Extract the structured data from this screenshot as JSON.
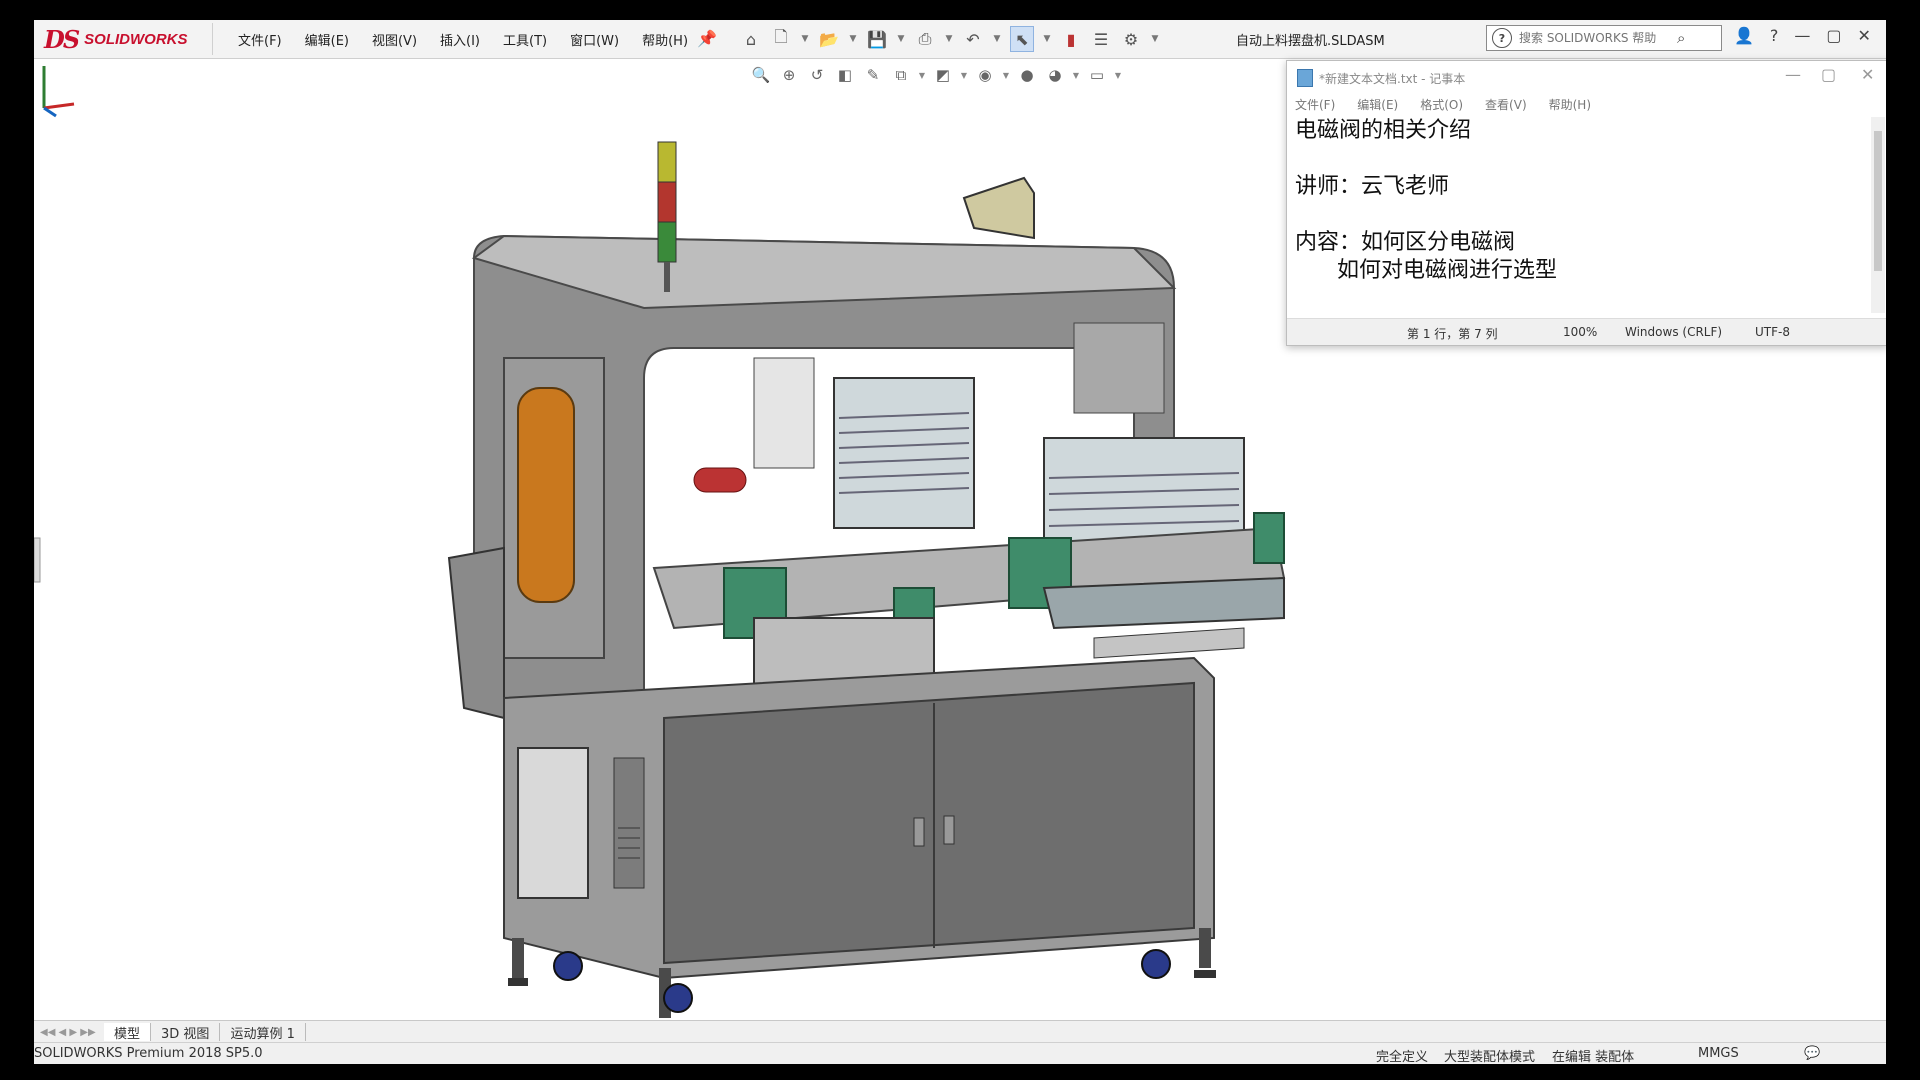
{
  "app": {
    "logo_mark": "DS",
    "logo_text": "SOLIDWORKS",
    "document_title": "自动上料摆盘机.SLDASM"
  },
  "menus": [
    "文件(F)",
    "编辑(E)",
    "视图(V)",
    "插入(I)",
    "工具(T)",
    "窗口(W)",
    "帮助(H)"
  ],
  "search": {
    "placeholder": "搜索 SOLIDWORKS 帮助"
  },
  "notepad": {
    "title": "*新建文本文档.txt - 记事本",
    "menus": [
      "文件(F)",
      "编辑(E)",
      "格式(O)",
      "查看(V)",
      "帮助(H)"
    ],
    "lines": [
      "电磁阀的相关介绍",
      "",
      "讲师：云飞老师",
      "",
      "内容：如何区分电磁阀",
      "      如何对电磁阀进行选型"
    ],
    "status": {
      "position": "第 1 行，第 7 列",
      "zoom": "100%",
      "line_ending": "Windows (CRLF)",
      "encoding": "UTF-8"
    }
  },
  "tabs": [
    "模型",
    "3D 视图",
    "运动算例 1"
  ],
  "status_bar": {
    "version": "SOLIDWORKS Premium 2018 SP5.0",
    "state1": "完全定义",
    "state2": "大型装配体模式",
    "state3": "在编辑 装配体",
    "units": "MMGS"
  },
  "colors": {
    "brand_red": "#c8102e",
    "machine_gray": "#8c8c8c",
    "panel_green": "#3f8c6a",
    "window_orange": "#c9781e"
  }
}
